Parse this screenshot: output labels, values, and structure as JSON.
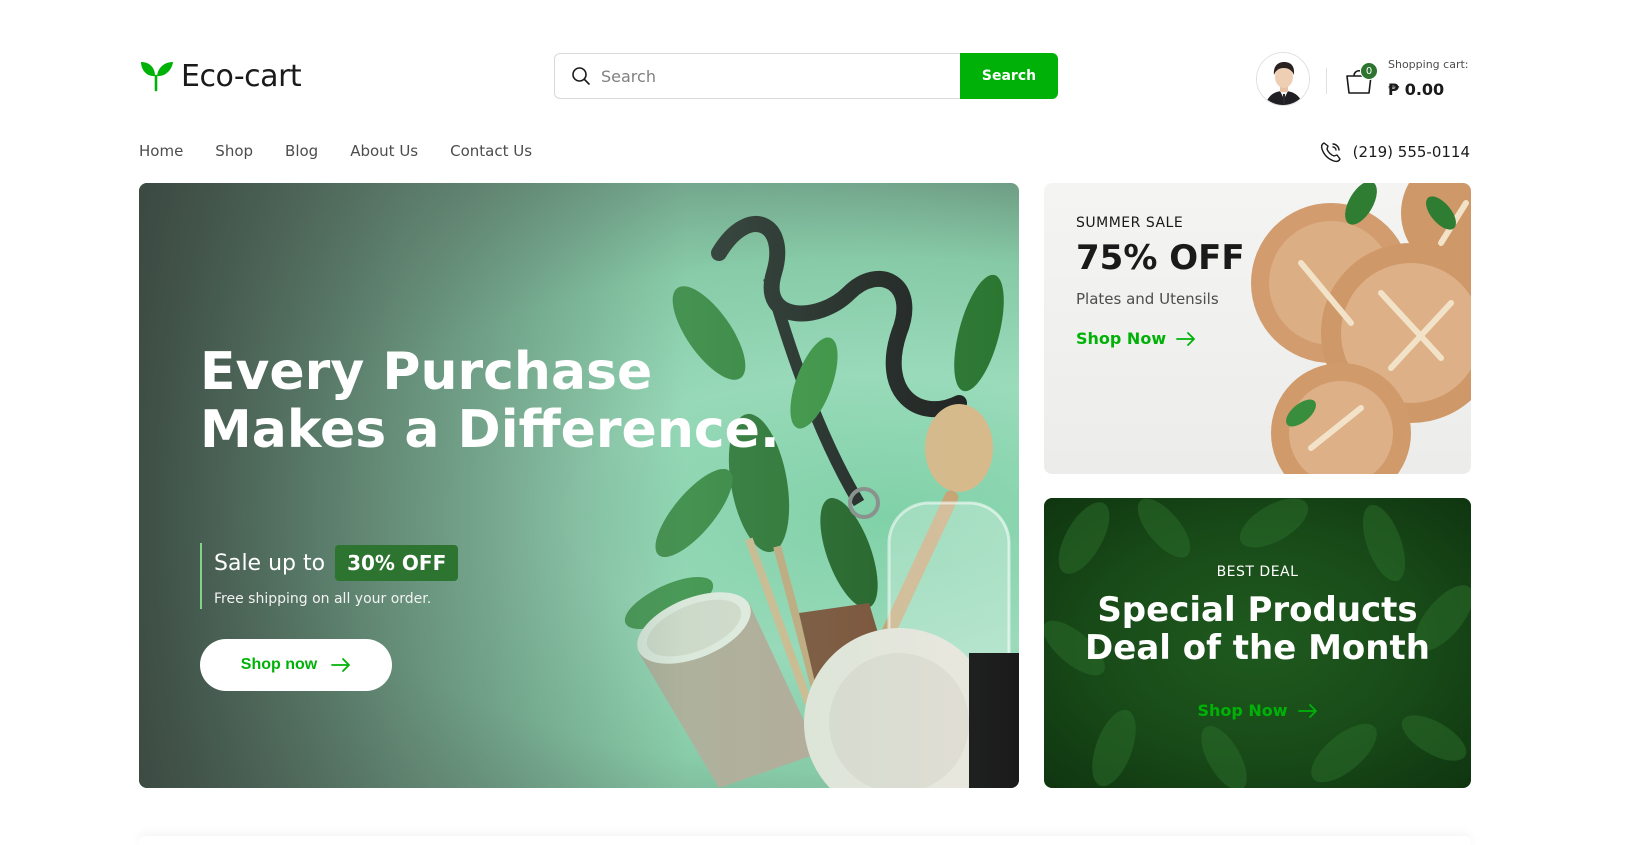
{
  "header": {
    "logo_text": "Eco-cart",
    "search": {
      "placeholder": "Search",
      "button_label": "Search"
    },
    "cart": {
      "count": "0",
      "label": "Shopping cart:",
      "total": "₱ 0.00"
    }
  },
  "nav": {
    "items": [
      {
        "label": "Home"
      },
      {
        "label": "Shop"
      },
      {
        "label": "Blog"
      },
      {
        "label": "About Us"
      },
      {
        "label": "Contact Us"
      }
    ],
    "phone": "(219) 555-0114"
  },
  "hero": {
    "title_line1": "Every Purchase",
    "title_line2": "Makes a Difference.",
    "sale_text": "Sale up to",
    "sale_badge": "30% OFF",
    "sale_sub": "Free shipping on all your order.",
    "button_label": "Shop now"
  },
  "summer_card": {
    "label": "SUMMER SALE",
    "headline": "75% OFF",
    "subtitle": "Plates and Utensils",
    "link_label": "Shop Now"
  },
  "deal_card": {
    "label": "BEST DEAL",
    "title_line1": "Special Products",
    "title_line2": "Deal of the Month",
    "link_label": "Shop Now"
  },
  "icons": {
    "logo": "leaf-icon",
    "search": "search-icon",
    "cart": "shopping-bag-icon",
    "phone": "phone-call-icon",
    "arrow": "arrow-right-icon"
  },
  "colors": {
    "primary": "#00b207",
    "dark_green": "#2c742f",
    "text": "#1a1a1a",
    "muted": "#4d4d4d"
  }
}
